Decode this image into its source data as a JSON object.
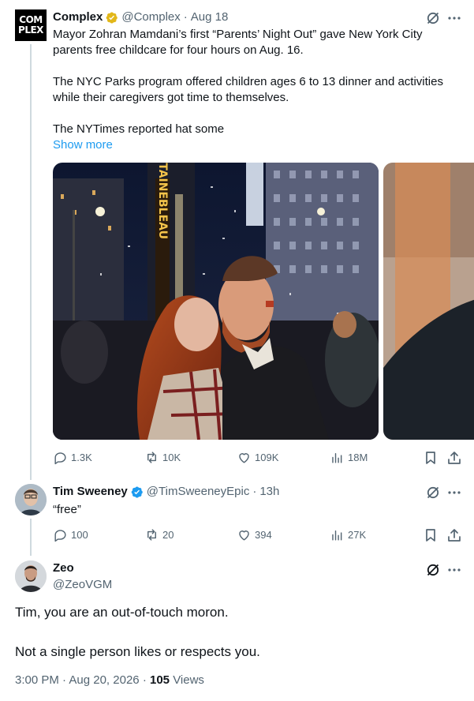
{
  "colors": {
    "text": "#0f1419",
    "secondary": "#536471",
    "link": "#1d9bf0",
    "verified_gold": "#e2b719",
    "verified_blue": "#1d9bf0",
    "thread_line": "#cfd9de"
  },
  "tweet1": {
    "avatar_text": "COM PLEX",
    "name": "Complex",
    "handle": "@Complex",
    "separator": "·",
    "date": "Aug 18",
    "text_1": "Mayor Zohran Mamdani’s first “Parents’ Night Out” gave New York City parents free childcare for four hours on Aug. 16.",
    "text_2": "The NYC Parks program offered children ages 6 to 13 dinner and activities while their caregivers got time to themselves.",
    "text_3": "The NYTimes reported hat some",
    "show_more": "Show more",
    "sign_text": "FONTAINEBLEAU",
    "replies": "1.3K",
    "reposts": "10K",
    "likes": "109K",
    "views": "18M"
  },
  "tweet2": {
    "name": "Tim Sweeney",
    "handle": "@TimSweeneyEpic",
    "separator": "·",
    "date": "13h",
    "text": "“free”",
    "replies": "100",
    "reposts": "20",
    "likes": "394",
    "views": "27K"
  },
  "tweet3": {
    "name": "Zeo",
    "handle": "@ZeoVGM",
    "text_1": "Tim, you are an out-of-touch moron.",
    "text_2": "Not a single person likes or respects you.",
    "time": "3:00 PM",
    "separator": "·",
    "date": "Aug 20, 2026",
    "views_count": "105",
    "views_label": "Views"
  },
  "icons": [
    "grok-icon",
    "more-icon",
    "reply-icon",
    "repost-icon",
    "like-icon",
    "views-icon",
    "bookmark-icon",
    "share-icon",
    "verified-badge-icon"
  ]
}
